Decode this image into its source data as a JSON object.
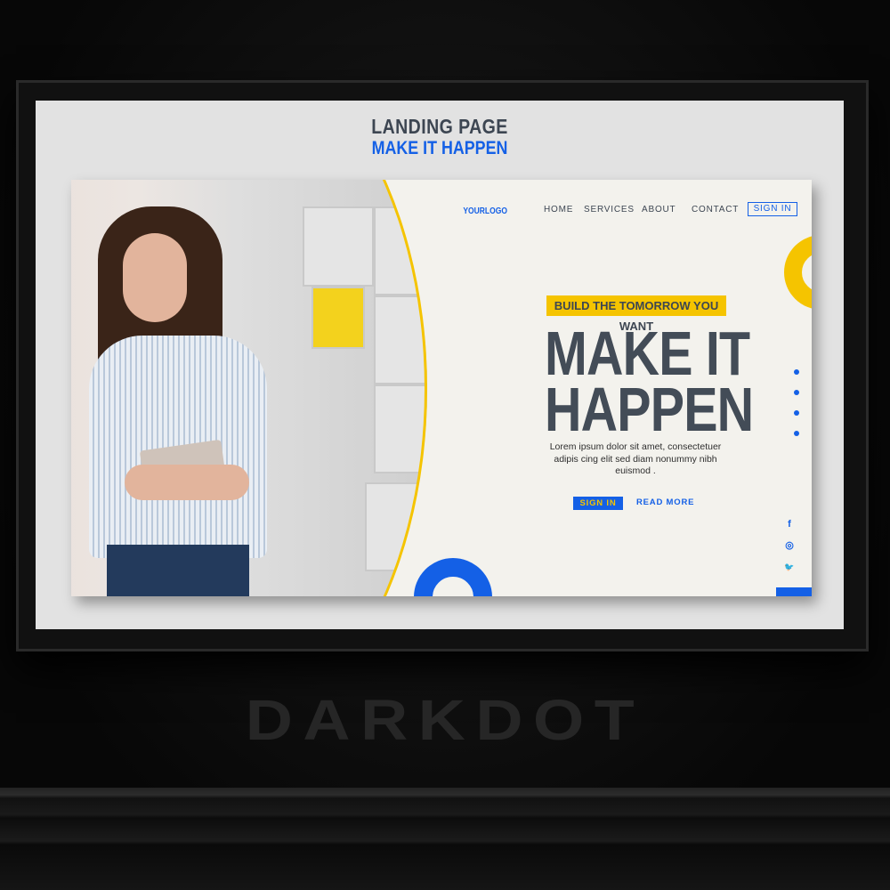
{
  "mockup": {
    "title": "LANDING PAGE",
    "subtitle": "MAKE IT HAPPEN",
    "watermark": "DARKDOT"
  },
  "site": {
    "logo": "YOURLOGO",
    "nav": [
      {
        "label": "HOME"
      },
      {
        "label": "SERVICES"
      },
      {
        "label": "ABOUT"
      },
      {
        "label": "CONTACT"
      }
    ],
    "sign_in": "SIGN IN",
    "hero": {
      "tagline": "BUILD THE TOMORROW YOU WANT",
      "headline_line1": "MAKE IT",
      "headline_line2": "HAPPEN",
      "body": "Lorem ipsum dolor sit amet, consectetuer adipis cing elit sed diam nonummy nibh euismod .",
      "primary_button": "SIGN IN",
      "secondary_link": "READ MORE"
    },
    "social": [
      {
        "icon": "facebook-icon",
        "glyph": "f"
      },
      {
        "icon": "instagram-icon",
        "glyph": "◎"
      },
      {
        "icon": "twitter-icon",
        "glyph": "🐦"
      }
    ],
    "colors": {
      "accent_blue": "#1460e6",
      "accent_yellow": "#f5c400",
      "text_dark": "#434c57",
      "background": "#f3f2ed"
    }
  }
}
